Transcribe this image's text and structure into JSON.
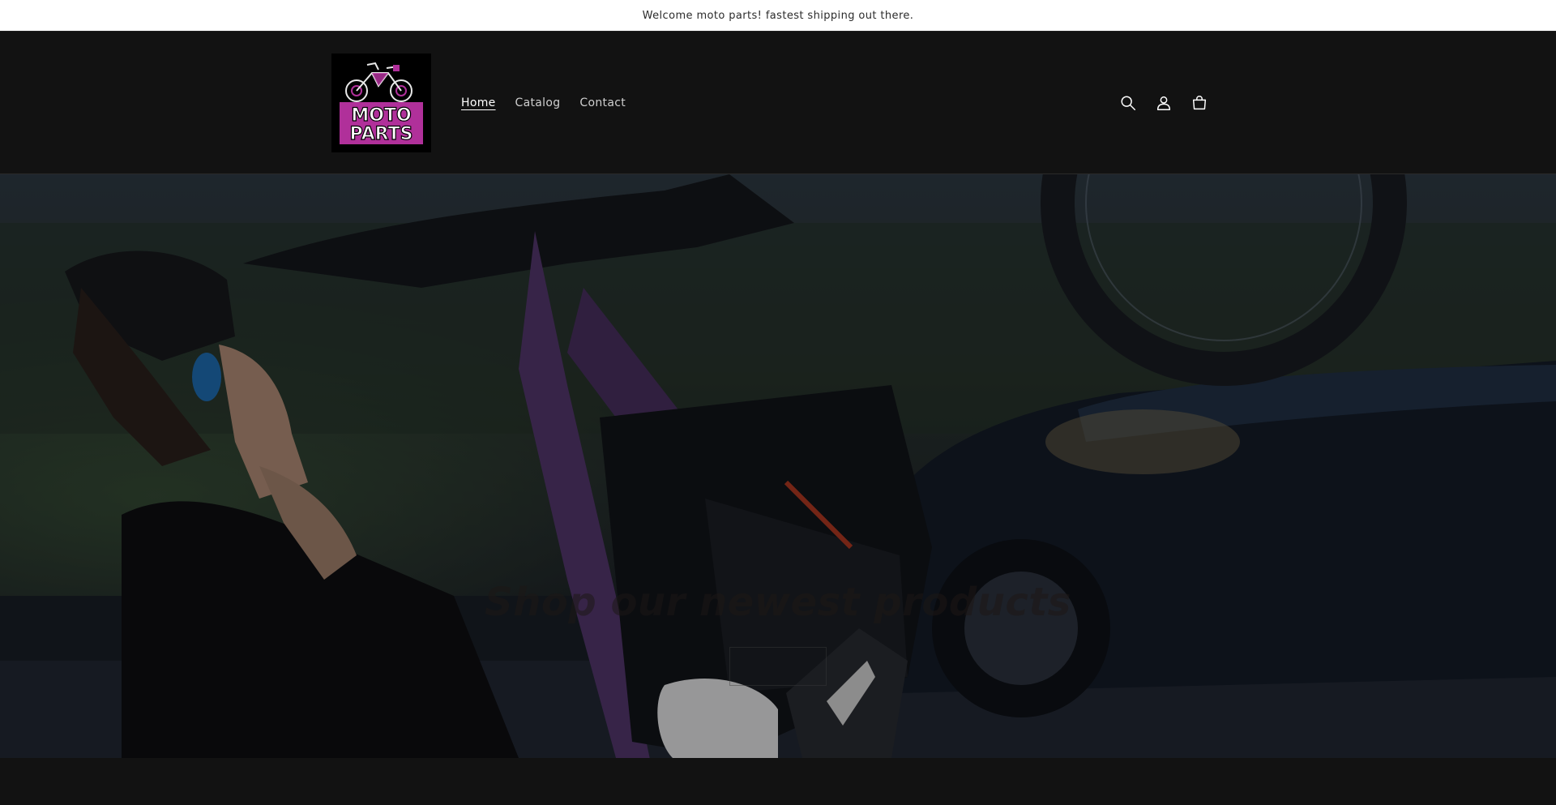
{
  "announcement": {
    "text": "Welcome moto parts! fastest shipping out there."
  },
  "header": {
    "logo": {
      "line1": "MOTO",
      "line2": "PARTS",
      "accent_color": "#b0309a"
    },
    "nav": [
      {
        "label": "Home",
        "active": true
      },
      {
        "label": "Catalog",
        "active": false
      },
      {
        "label": "Contact",
        "active": false
      }
    ],
    "icons": [
      "search-icon",
      "account-icon",
      "cart-icon"
    ]
  },
  "hero": {
    "heading": "Shop our newest products",
    "button_label": ""
  },
  "colors": {
    "background": "#121212",
    "announcement_bg": "#ffffff",
    "nav_text": "#cfcfcf",
    "bike_purple": "#5b3b8a"
  }
}
